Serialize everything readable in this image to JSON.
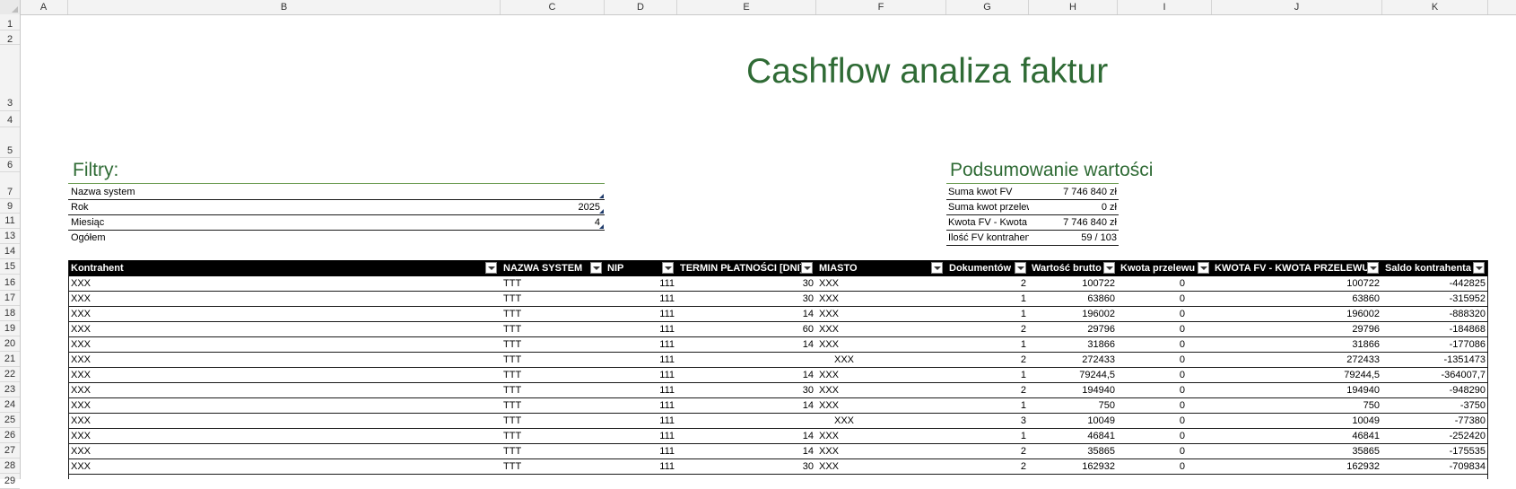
{
  "spreadsheet": {
    "columns": [
      "A",
      "B",
      "C",
      "D",
      "E",
      "F",
      "G",
      "H",
      "I",
      "J",
      "K"
    ],
    "rows": [
      "1",
      "2",
      "3",
      "4",
      "5",
      "6",
      "7",
      "9",
      "11",
      "13",
      "14",
      "15",
      "16",
      "17",
      "18",
      "19",
      "20",
      "21",
      "22",
      "23",
      "24",
      "25",
      "26",
      "27",
      "28",
      "29"
    ]
  },
  "title": "Cashflow analiza faktur",
  "filters": {
    "heading": "Filtry:",
    "items": [
      {
        "label": "Nazwa system",
        "value": ""
      },
      {
        "label": "Rok",
        "value": "2025"
      },
      {
        "label": "Miesiąc",
        "value": "4"
      },
      {
        "label": "Ogółem",
        "value": ""
      }
    ]
  },
  "summary": {
    "heading": "Podsumowanie wartości",
    "items": [
      {
        "label": "Suma kwot FV",
        "value": "7 746 840 zł"
      },
      {
        "label": "Suma kwot przelewów",
        "value": "0 zł"
      },
      {
        "label": "Kwota FV - Kwota przelewów",
        "value": "7 746 840 zł"
      },
      {
        "label": "Ilość FV kontrahenta",
        "value": "59 / 103"
      }
    ]
  },
  "table": {
    "headers": [
      "Kontrahent",
      "NAZWA SYSTEM",
      "NIP",
      "TERMIN PŁATNOŚCI [DNI]",
      "MIASTO",
      "Dokumentów",
      "Wartość brutto",
      "Kwota przelewu",
      "KWOTA FV - KWOTA PRZELEWU",
      "Saldo kontrahenta"
    ],
    "rows": [
      [
        "XXX",
        "TTT",
        "111",
        "30",
        "XXX",
        "2",
        "100722",
        "0",
        "100722",
        "-442825"
      ],
      [
        "XXX",
        "TTT",
        "111",
        "30",
        "XXX",
        "1",
        "63860",
        "0",
        "63860",
        "-315952"
      ],
      [
        "XXX",
        "TTT",
        "111",
        "14",
        "XXX",
        "1",
        "196002",
        "0",
        "196002",
        "-888320"
      ],
      [
        "XXX",
        "TTT",
        "111",
        "60",
        "XXX",
        "2",
        "29796",
        "0",
        "29796",
        "-184868"
      ],
      [
        "XXX",
        "TTT",
        "111",
        "14",
        "XXX",
        "1",
        "31866",
        "0",
        "31866",
        "-177086"
      ],
      [
        "XXX",
        "TTT",
        "111",
        "",
        "XXX",
        "2",
        "272433",
        "0",
        "272433",
        "-1351473"
      ],
      [
        "XXX",
        "TTT",
        "111",
        "14",
        "XXX",
        "1",
        "79244,5",
        "0",
        "79244,5",
        "-364007,7"
      ],
      [
        "XXX",
        "TTT",
        "111",
        "30",
        "XXX",
        "2",
        "194940",
        "0",
        "194940",
        "-948290"
      ],
      [
        "XXX",
        "TTT",
        "111",
        "14",
        "XXX",
        "1",
        "750",
        "0",
        "750",
        "-3750"
      ],
      [
        "XXX",
        "TTT",
        "111",
        "",
        "XXX",
        "3",
        "10049",
        "0",
        "10049",
        "-77380"
      ],
      [
        "XXX",
        "TTT",
        "111",
        "14",
        "XXX",
        "1",
        "46841",
        "0",
        "46841",
        "-252420"
      ],
      [
        "XXX",
        "TTT",
        "111",
        "14",
        "XXX",
        "2",
        "35865",
        "0",
        "35865",
        "-175535"
      ],
      [
        "XXX",
        "TTT",
        "111",
        "30",
        "XXX",
        "2",
        "162932",
        "0",
        "162932",
        "-709834"
      ]
    ]
  }
}
